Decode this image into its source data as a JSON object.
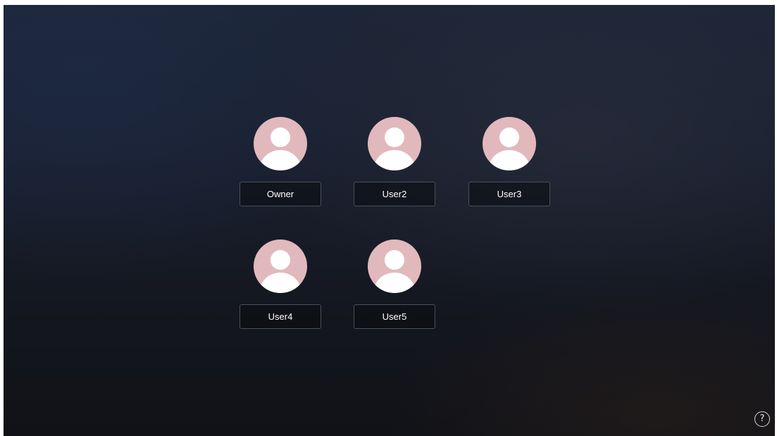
{
  "users": [
    {
      "name": "Owner"
    },
    {
      "name": "User2"
    },
    {
      "name": "User3"
    },
    {
      "name": "User4"
    },
    {
      "name": "User5"
    }
  ],
  "help": {
    "glyph": "?",
    "icon": "help-icon"
  },
  "colors": {
    "avatar_background": "#e1b9bc",
    "avatar_figure": "#ffffff",
    "button_border": "#4b4f58",
    "text": "#ffffff"
  }
}
